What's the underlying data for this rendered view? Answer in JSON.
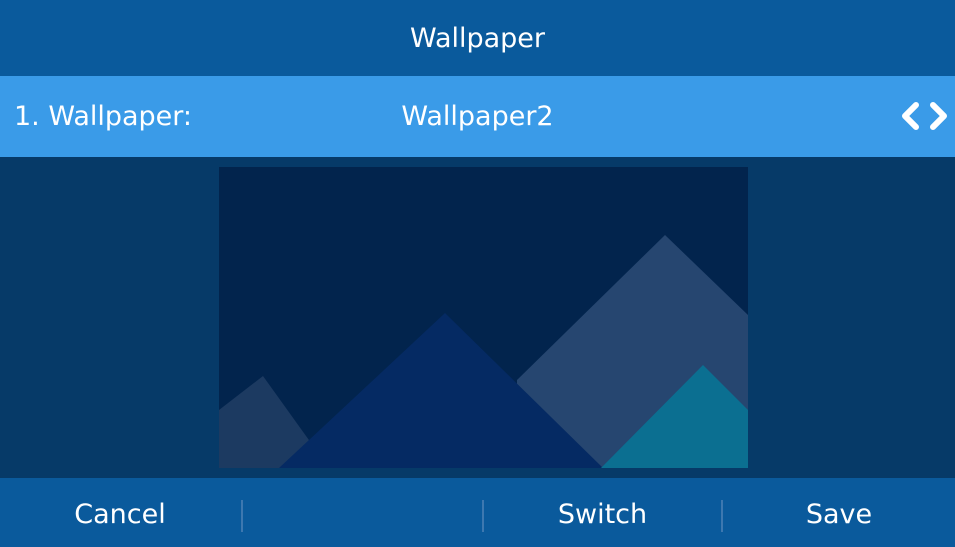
{
  "header": {
    "title": "Wallpaper"
  },
  "setting": {
    "label": "1. Wallpaper:",
    "value": "Wallpaper2",
    "prev_icon": "chevron-left-icon",
    "next_icon": "chevron-right-icon"
  },
  "softkeys": {
    "cancel": "Cancel",
    "empty": "",
    "switch": "Switch",
    "save": "Save"
  },
  "colors": {
    "title_bar": "#0a5a9c",
    "selected_row": "#3a9be8",
    "background": "#063a68",
    "preview_sky": "#02244d",
    "mountain_large": "#052a63",
    "mountain_back": "#264670",
    "mountain_small": "#1c3a61",
    "mountain_teal": "#0b6f91"
  }
}
